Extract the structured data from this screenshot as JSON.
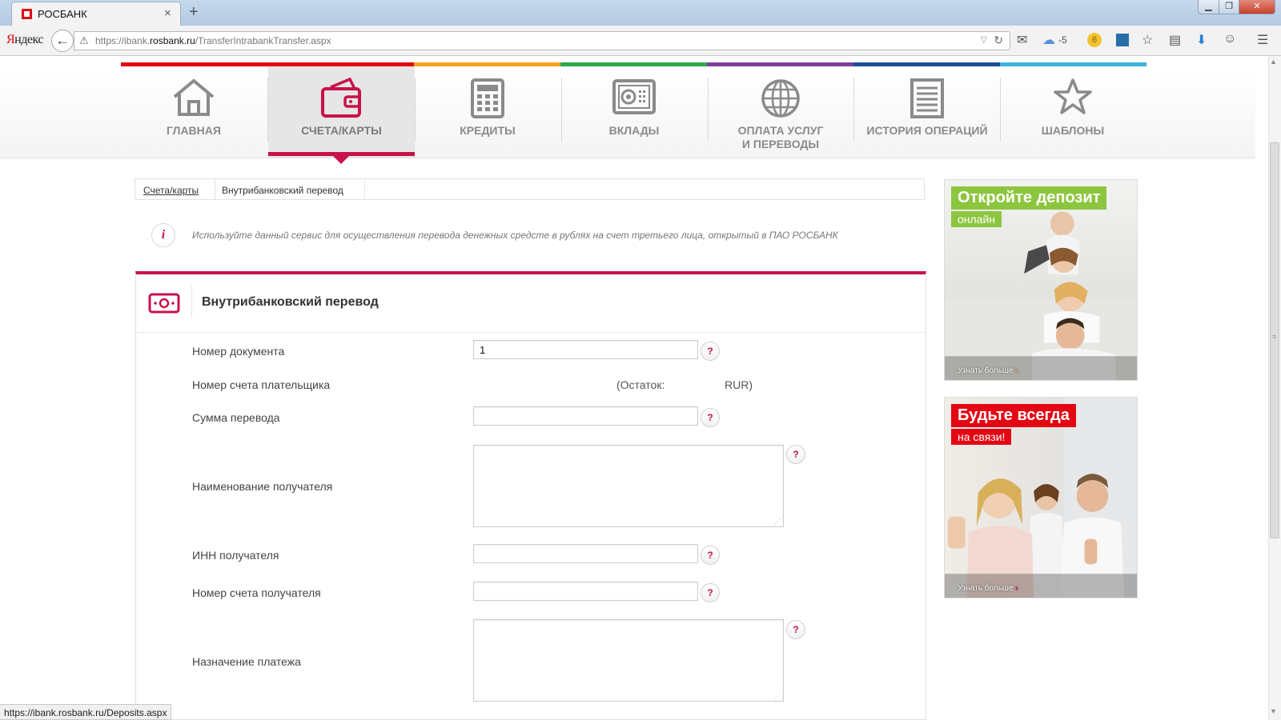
{
  "browser": {
    "tab_title": "РОСБАНК",
    "tab_close": "×",
    "new_tab": "+",
    "yandex_brand_first": "Я",
    "yandex_brand_rest": "ндекс",
    "url_prefix": "https://ibank.",
    "url_domain": "rosbank.ru",
    "url_path": "/TransferIntrabankTransfer.aspx",
    "status_url": "https://ibank.rosbank.ru/Deposits.aspx",
    "weather_badge": "-5",
    "toolbar_icons": [
      "mail-icon",
      "cloud-icon",
      "badge-6-icon",
      "bookmark-icon",
      "star-icon",
      "reader-icon",
      "download-icon",
      "chat-icon",
      "menu-icon"
    ]
  },
  "site": {
    "brand_strip_colors": [
      "#e30613",
      "#f7a41d",
      "#2aa84a",
      "#7c3e98",
      "#1d4c9b",
      "#3bb3d6"
    ],
    "accent_color": "#c8124a",
    "menu": [
      {
        "label": "ГЛАВНАЯ",
        "icon": "home-icon",
        "active": false
      },
      {
        "label": "СЧЕТА/КАРТЫ",
        "icon": "wallet-icon",
        "active": true
      },
      {
        "label": "КРЕДИТЫ",
        "icon": "calculator-icon",
        "active": false
      },
      {
        "label": "ВКЛАДЫ",
        "icon": "safe-icon",
        "active": false
      },
      {
        "label_line1": "ОПЛАТА УСЛУГ",
        "label_line2": "И ПЕРЕВОДЫ",
        "icon": "globe-icon",
        "active": false
      },
      {
        "label": "ИСТОРИЯ ОПЕРАЦИЙ",
        "icon": "document-list-icon",
        "active": false
      },
      {
        "label": "ШАБЛОНЫ",
        "icon": "star-icon",
        "active": false
      }
    ]
  },
  "breadcrumb": {
    "parent": "Счета/карты",
    "current": "Внутрибанковский перевод"
  },
  "info": {
    "icon_glyph": "i",
    "text": "Используйте данный сервис для осуществления перевода денежных средсте в рублях на счет третьего лица, открытый в ПАО РОСБАНК"
  },
  "form": {
    "title": "Внутрибанковский перевод",
    "help_glyph": "?",
    "fields": {
      "doc_number": {
        "label": "Номер документа",
        "value": "1"
      },
      "payer_account": {
        "label": "Номер счета плательщика",
        "balance_prefix": "(Остаток:",
        "balance_suffix": "RUR)"
      },
      "amount": {
        "label": "Сумма перевода",
        "value": ""
      },
      "recipient_name": {
        "label": "Наименование получателя",
        "value": ""
      },
      "recipient_inn": {
        "label": "ИНН получателя",
        "value": ""
      },
      "recipient_account": {
        "label": "Номер счета получателя",
        "value": ""
      },
      "purpose": {
        "label": "Назначение платежа",
        "value": ""
      }
    }
  },
  "promos": [
    {
      "title": "Откройте депозит",
      "subtitle": "онлайн",
      "more": "Узнать больше",
      "title_color": "#8cc63f"
    },
    {
      "title": "Будьте всегда",
      "subtitle": "на связи!",
      "more": "Узнать больше",
      "title_color": "#e30613"
    }
  ]
}
